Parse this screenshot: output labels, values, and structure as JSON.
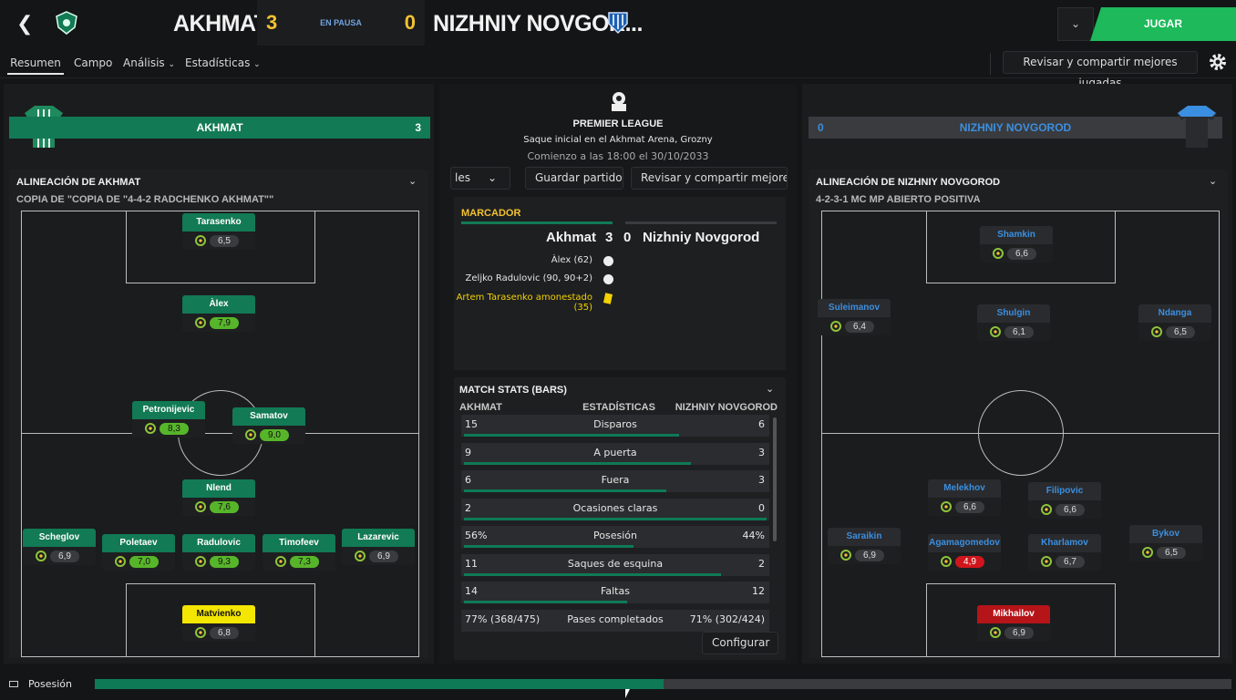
{
  "header": {
    "home_team": "AKHMAT",
    "home_score": "3",
    "status": "EN PAUSA",
    "away_score": "0",
    "away_team": "NIZHNIY NOVGOR...",
    "play_button": "JUGAR"
  },
  "nav": {
    "tabs": [
      "Resumen",
      "Campo",
      "Análisis",
      "Estadísticas"
    ],
    "review_button": "Revisar y compartir mejores jugadas"
  },
  "home": {
    "banner_name": "AKHMAT",
    "banner_score": "3",
    "lineup_title": "ALINEACIÓN DE AKHMAT",
    "formation": "COPIA DE \"COPIA DE \"4-4-2 RADCHENKO AKHMAT\"\"",
    "players": [
      {
        "name": "Tarasenko",
        "rating": "6,5",
        "good": false
      },
      {
        "name": "Àlex",
        "rating": "7,9",
        "good": true
      },
      {
        "name": "Petronijevic",
        "rating": "8,3",
        "good": true
      },
      {
        "name": "Samatov",
        "rating": "9,0",
        "good": true
      },
      {
        "name": "Nlend",
        "rating": "7,6",
        "good": true
      },
      {
        "name": "Scheglov",
        "rating": "6,9",
        "good": false
      },
      {
        "name": "Poletaev",
        "rating": "7,0",
        "good": true
      },
      {
        "name": "Radulovic",
        "rating": "9,3",
        "good": true
      },
      {
        "name": "Timofeev",
        "rating": "7,3",
        "good": true
      },
      {
        "name": "Lazarevic",
        "rating": "6,9",
        "good": false
      },
      {
        "name": "Matvienko",
        "rating": "6,8",
        "good": false
      }
    ]
  },
  "away": {
    "banner_score": "0",
    "banner_name": "NIZHNIY NOVGOROD",
    "lineup_title": "ALINEACIÓN DE NIZHNIY NOVGOROD",
    "formation": "4-2-3-1 MC MP ABIERTO POSITIVA",
    "players": [
      {
        "name": "Shamkin",
        "rating": "6,6"
      },
      {
        "name": "Suleimanov",
        "rating": "6,4"
      },
      {
        "name": "Shulgin",
        "rating": "6,1"
      },
      {
        "name": "Ndanga",
        "rating": "6,5"
      },
      {
        "name": "Melekhov",
        "rating": "6,6"
      },
      {
        "name": "Filipovic",
        "rating": "6,6"
      },
      {
        "name": "Saraikin",
        "rating": "6,9"
      },
      {
        "name": "Agamagomedov",
        "rating": "4,9"
      },
      {
        "name": "Kharlamov",
        "rating": "6,7"
      },
      {
        "name": "Bykov",
        "rating": "6,5"
      },
      {
        "name": "Mikhailov",
        "rating": "6,9"
      }
    ]
  },
  "match": {
    "competition": "PREMIER LEAGUE",
    "venue": "Saque inicial en el Akhmat Arena, Grozny",
    "kickoff": "Comienzo a las 18:00 el 30/10/2033",
    "tab_partial": "les",
    "save_button": "Guardar partido",
    "review_button": "Revisar y compartir mejores ju"
  },
  "scoreboard": {
    "title": "MARCADOR",
    "home": "Akhmat",
    "home_score": "3",
    "away_score": "0",
    "away": "Nizhniy Novgorod",
    "events": [
      "Àlex (62)",
      "Zeljko Radulovic (90, 90+2)",
      "Artem Tarasenko amonestado (35)"
    ]
  },
  "stats": {
    "title": "MATCH STATS (BARS)",
    "home_header": "AKHMAT",
    "center_header": "ESTADÍSTICAS",
    "away_header": "NIZHNIY NOVGOROD",
    "rows": [
      {
        "home": "15",
        "label": "Disparos",
        "away": "6",
        "home_share": 0.71
      },
      {
        "home": "9",
        "label": "A puerta",
        "away": "3",
        "home_share": 0.75
      },
      {
        "home": "6",
        "label": "Fuera",
        "away": "3",
        "home_share": 0.67
      },
      {
        "home": "2",
        "label": "Ocasiones claras",
        "away": "0",
        "home_share": 1.0
      },
      {
        "home": "56%",
        "label": "Posesión",
        "away": "44%",
        "home_share": 0.56
      },
      {
        "home": "11",
        "label": "Saques de esquina",
        "away": "2",
        "home_share": 0.85
      },
      {
        "home": "14",
        "label": "Faltas",
        "away": "12",
        "home_share": 0.54
      },
      {
        "home": "77% (368/475)",
        "label": "Pases completados",
        "away": "71% (302/424)",
        "home_share": 0.5
      }
    ],
    "configure": "Configurar"
  },
  "possession": {
    "label": "Posesión",
    "home_share": 0.5
  },
  "colors": {
    "home": "#127a55",
    "accent": "#1db95a",
    "away": "#3b8fe0",
    "score": "#f2c230"
  }
}
